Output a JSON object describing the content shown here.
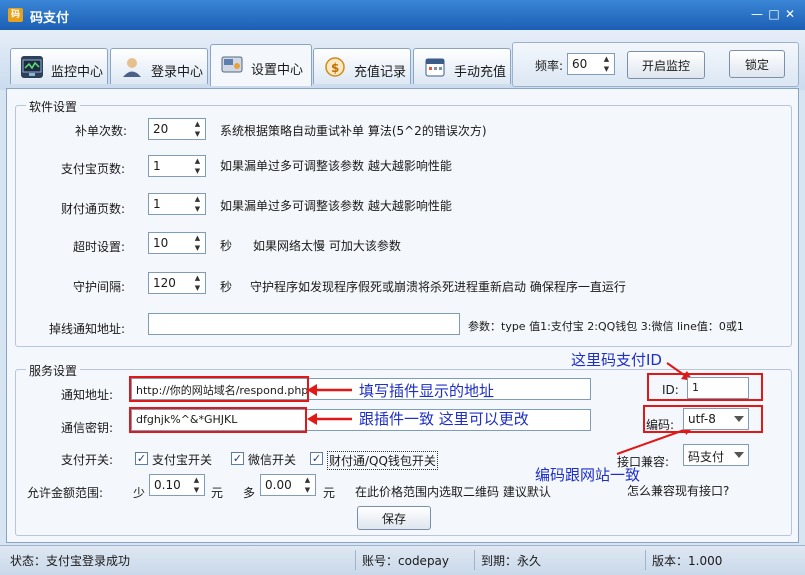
{
  "window": {
    "title": "码支付",
    "icon_text": "码"
  },
  "tabs": [
    {
      "label": "监控中心"
    },
    {
      "label": "登录中心"
    },
    {
      "label": "设置中心"
    },
    {
      "label": "充值记录"
    },
    {
      "label": "手动充值"
    }
  ],
  "toolbar": {
    "freq_label": "频率:",
    "freq_value": "60",
    "start_monitor_label": "开启监控",
    "lock_label": "锁定"
  },
  "software_settings": {
    "title": "软件设置",
    "rows": [
      {
        "label": "补单次数:",
        "value": "20",
        "desc": "系统根据策略自动重试补单 算法(5^2的错误次方)"
      },
      {
        "label": "支付宝页数:",
        "value": "1",
        "desc": "如果漏单过多可调整该参数 越大越影响性能"
      },
      {
        "label": "财付通页数:",
        "value": "1",
        "desc": "如果漏单过多可调整该参数 越大越影响性能"
      },
      {
        "label": "超时设置:",
        "value": "10",
        "unit": "秒",
        "desc": "如果网络太慢 可加大该参数"
      },
      {
        "label": "守护间隔:",
        "value": "120",
        "unit": "秒",
        "desc": "守护程序如发现程序假死或崩溃将杀死进程重新启动 确保程序一直运行"
      }
    ],
    "offline_label": "掉线通知地址:",
    "offline_value": "",
    "params_text": "参数：type 值1:支付宝 2:QQ钱包 3:微信  line值：0或1"
  },
  "service_settings": {
    "title": "服务设置",
    "notify_label": "通知地址:",
    "notify_value": "http://你的网站域名/respond.php",
    "secret_label": "通信密钥:",
    "secret_value": "dfghjk%^&*GHJKL",
    "id_label": "ID:",
    "id_value": "1",
    "encoding_label": "编码:",
    "encoding_value": "utf-8",
    "pay_switch_label": "支付开关:",
    "alipay_label": "支付宝开关",
    "wechat_label": "微信开关",
    "tenpay_label": "财付通/QQ钱包开关",
    "compat_label": "接口兼容:",
    "compat_value": "码支付",
    "amount_label": "允许金额范围:",
    "min_label": "少",
    "min_value": "0.10",
    "yuan1": "元",
    "max_label": "多",
    "max_value": "0.00",
    "yuan2": "元",
    "range_desc": "在此价格范围内选取二维码 建议默认",
    "compat_question": "怎么兼容现有接口?",
    "save_label": "保存"
  },
  "annotations": {
    "notify_hint": "填写插件显示的地址",
    "secret_hint": "跟插件一致  这里可以更改",
    "id_hint": "这里码支付ID",
    "encoding_hint": "编码跟网站一致"
  },
  "status": {
    "state": "状态：支付宝登录成功",
    "account": "账号：codepay",
    "expire": "到期：永久",
    "version": "版本：1.000"
  },
  "colors": {
    "accent_red": "#e01818",
    "annotation_blue": "#1d2fc8",
    "title_blue": "#1b5fb4"
  }
}
